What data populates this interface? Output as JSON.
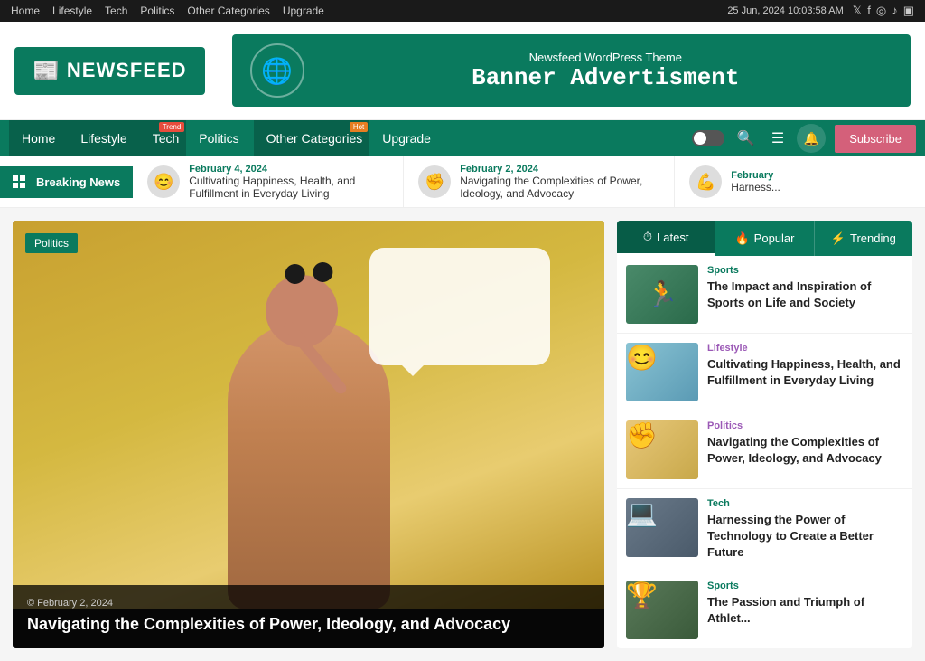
{
  "topbar": {
    "nav_items": [
      "Home",
      "Lifestyle",
      "Tech",
      "Politics",
      "Other Categories",
      "Upgrade"
    ],
    "datetime": "25 Jun, 2024 10:03:58 AM",
    "social": [
      "𝕏",
      "f",
      "📷",
      "♪",
      "📱"
    ]
  },
  "header": {
    "logo_text": "NEWSFEED",
    "banner_small": "Newsfeed WordPress Theme",
    "banner_large": "Banner Advertisment"
  },
  "mainnav": {
    "items": [
      {
        "label": "Home",
        "badge": ""
      },
      {
        "label": "Lifestyle",
        "badge": ""
      },
      {
        "label": "Tech",
        "badge": "Trend"
      },
      {
        "label": "Politics",
        "badge": ""
      },
      {
        "label": "Other Categories",
        "badge": "Hot"
      },
      {
        "label": "Upgrade",
        "badge": ""
      }
    ],
    "subscribe_label": "Subscribe"
  },
  "breaking": {
    "label": "Breaking News",
    "items": [
      {
        "date": "February 4, 2024",
        "title": "Cultivating Happiness, Health, and Fulfillment in Everyday Living"
      },
      {
        "date": "February 2, 2024",
        "title": "Navigating the Complexities of Power, Ideology, and Advocacy"
      },
      {
        "date": "February",
        "title": "Harness..."
      }
    ]
  },
  "main_article": {
    "category": "Politics",
    "date": "© February 2, 2024",
    "title": "Navigating the Complexities of Power, Ideology, and Advocacy"
  },
  "sidebar": {
    "tabs": [
      {
        "label": "Latest",
        "icon": "⏱"
      },
      {
        "label": "Popular",
        "icon": "🔥"
      },
      {
        "label": "Trending",
        "icon": "⚡"
      }
    ],
    "articles": [
      {
        "category": "Sports",
        "cat_class": "cat-sports",
        "thumb_class": "thumb-sports",
        "title": "The Impact and Inspiration of Sports on Life and Society"
      },
      {
        "category": "Lifestyle",
        "cat_class": "cat-lifestyle",
        "thumb_class": "thumb-lifestyle",
        "title": "Cultivating Happiness, Health, and Fulfillment in Everyday Living"
      },
      {
        "category": "Politics",
        "cat_class": "cat-politics",
        "thumb_class": "thumb-politics",
        "title": "Navigating the Complexities of Power, Ideology, and Advocacy"
      },
      {
        "category": "Tech",
        "cat_class": "cat-tech",
        "thumb_class": "thumb-tech",
        "title": "Harnessing the Power of Technology to Create a Better Future"
      },
      {
        "category": "Sports",
        "cat_class": "cat-sports",
        "thumb_class": "thumb-sports2",
        "title": "The Passion and Triumph of Athlet..."
      }
    ]
  }
}
